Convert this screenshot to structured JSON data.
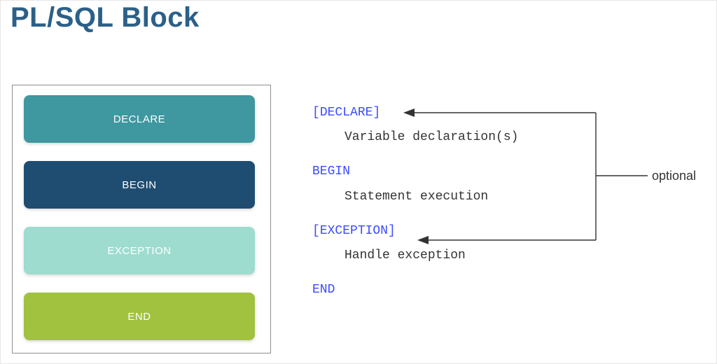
{
  "title": "PL/SQL Block",
  "blocks": {
    "b0": "DECLARE",
    "b1": "BEGIN",
    "b2": "EXCEPTION",
    "b3": "END"
  },
  "code": {
    "declare_kw": "DECLARE",
    "declare_brL": "[",
    "declare_brR": "]",
    "declare_body": "Variable declaration(s)",
    "begin_kw": "BEGIN",
    "begin_body": "Statement execution",
    "exception_kw": "EXCEPTION",
    "exception_brL": "[",
    "exception_brR": "]",
    "exception_body": "Handle exception",
    "end_kw": "END"
  },
  "annotation": {
    "optional": "optional"
  }
}
